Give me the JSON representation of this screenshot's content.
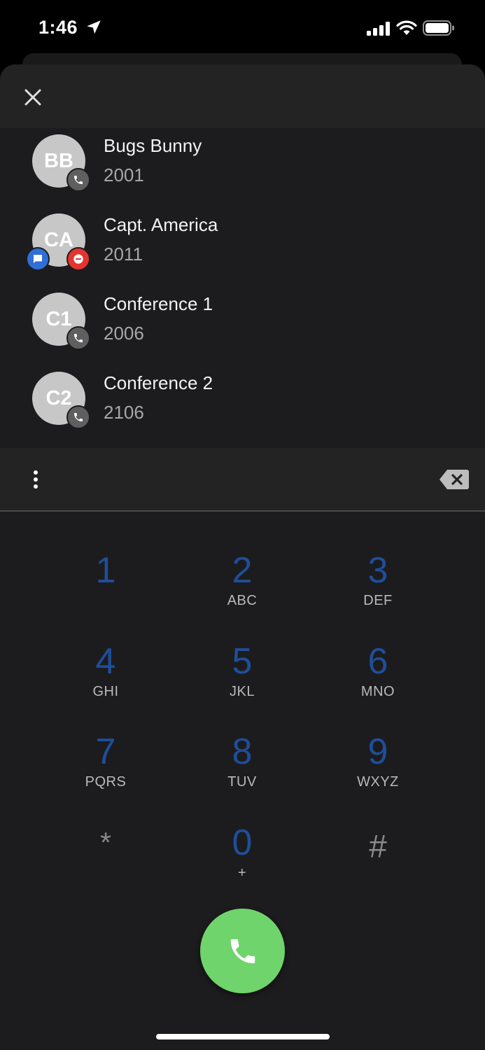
{
  "status_bar": {
    "time": "1:46",
    "icons": [
      "location-arrow-icon",
      "cellular-signal-icon",
      "wifi-icon",
      "battery-icon"
    ]
  },
  "header": {
    "close_icon": "close-icon"
  },
  "contacts": [
    {
      "initials": "BB",
      "name": "Bugs Bunny",
      "extension": "2001",
      "badges": [
        "phone-icon"
      ]
    },
    {
      "initials": "CA",
      "name": "Capt. America",
      "extension": "2011",
      "badges": [
        "chat-icon",
        "do-not-disturb-icon"
      ]
    },
    {
      "initials": "C1",
      "name": "Conference 1",
      "extension": "2006",
      "badges": [
        "phone-icon"
      ]
    },
    {
      "initials": "C2",
      "name": "Conference 2",
      "extension": "2106",
      "badges": [
        "phone-icon"
      ]
    }
  ],
  "action_bar": {
    "more_icon": "more-vertical-icon",
    "backspace_icon": "backspace-icon"
  },
  "keypad": {
    "keys": [
      {
        "digit": "1",
        "letters": ""
      },
      {
        "digit": "2",
        "letters": "ABC"
      },
      {
        "digit": "3",
        "letters": "DEF"
      },
      {
        "digit": "4",
        "letters": "GHI"
      },
      {
        "digit": "5",
        "letters": "JKL"
      },
      {
        "digit": "6",
        "letters": "MNO"
      },
      {
        "digit": "7",
        "letters": "PQRS"
      },
      {
        "digit": "8",
        "letters": "TUV"
      },
      {
        "digit": "9",
        "letters": "WXYZ"
      },
      {
        "digit": "*",
        "letters": ""
      },
      {
        "digit": "0",
        "letters": "+"
      },
      {
        "digit": "#",
        "letters": ""
      }
    ]
  },
  "call_button": {
    "icon": "phone-icon",
    "color": "#6fd46b"
  },
  "colors": {
    "digit": "#1f4e9a",
    "background": "#1c1c1e",
    "chat_badge": "#2f6fd6",
    "dnd_badge": "#e3342f"
  }
}
